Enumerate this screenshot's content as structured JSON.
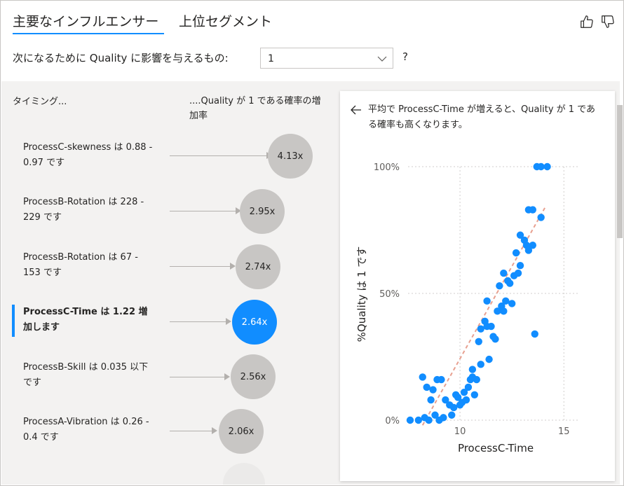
{
  "tabs": [
    {
      "label": "主要なインフルエンサー",
      "active": true
    },
    {
      "label": "上位セグメント",
      "active": false
    }
  ],
  "feedback": {
    "like_icon": "thumbs-up-icon",
    "dislike_icon": "thumbs-down-icon"
  },
  "question": {
    "text": "次になるために Quality に影響を与えるもの:",
    "selected_value": "1",
    "help": "?"
  },
  "influencers": {
    "col_header_left": "タイミング...",
    "col_header_right": "....Quality が 1 である確率の増加率",
    "items": [
      {
        "label": "ProcessC-skewness は 0.88 - 0.97 です",
        "multiplier": "4.13x",
        "value": 4.13,
        "selected": false
      },
      {
        "label": "ProcessB-Rotation は 228 - 229 です",
        "multiplier": "2.95x",
        "value": 2.95,
        "selected": false
      },
      {
        "label": "ProcessB-Rotation は 67 - 153 です",
        "multiplier": "2.74x",
        "value": 2.74,
        "selected": false
      },
      {
        "label": "ProcessC-Time は 1.22 増加します",
        "multiplier": "2.64x",
        "value": 2.64,
        "selected": true
      },
      {
        "label": "ProcessB-Skill は 0.035 以下です",
        "multiplier": "2.56x",
        "value": 2.56,
        "selected": false
      },
      {
        "label": "ProcessA-Vibration は 0.26 - 0.4 です",
        "multiplier": "2.06x",
        "value": 2.06,
        "selected": false
      }
    ]
  },
  "detail": {
    "back_icon": "arrow-left-icon",
    "description": "平均で ProcessC-Time が増えると、Quality が 1 である確率も高くなります。"
  },
  "chart_data": {
    "type": "scatter",
    "xlabel": "ProcessC-Time",
    "ylabel": "%Quality は 1 です",
    "xlim": [
      7.5,
      15.7
    ],
    "ylim": [
      0,
      100
    ],
    "x_ticks": [
      10,
      15
    ],
    "y_ticks": [
      {
        "value": 0,
        "label": "0%"
      },
      {
        "value": 50,
        "label": "50%"
      },
      {
        "value": 100,
        "label": "100%"
      }
    ],
    "grid": true,
    "point_color": "#118dff",
    "trend_color": "#e8a090",
    "trendline": {
      "x": [
        8.2,
        14.1
      ],
      "y": [
        -2,
        84
      ]
    },
    "points": [
      [
        7.6,
        0
      ],
      [
        8.0,
        0
      ],
      [
        8.5,
        0
      ],
      [
        9.0,
        0
      ],
      [
        8.3,
        1
      ],
      [
        8.8,
        2
      ],
      [
        9.2,
        1
      ],
      [
        9.6,
        2
      ],
      [
        8.2,
        17
      ],
      [
        8.4,
        13
      ],
      [
        8.7,
        12
      ],
      [
        8.6,
        8
      ],
      [
        8.9,
        16
      ],
      [
        9.1,
        16
      ],
      [
        9.3,
        8
      ],
      [
        9.5,
        6
      ],
      [
        9.7,
        5
      ],
      [
        9.8,
        10
      ],
      [
        9.9,
        9
      ],
      [
        10.0,
        6
      ],
      [
        10.1,
        7
      ],
      [
        10.2,
        11
      ],
      [
        10.3,
        8
      ],
      [
        10.4,
        13
      ],
      [
        10.5,
        16
      ],
      [
        10.6,
        17
      ],
      [
        10.6,
        20
      ],
      [
        10.7,
        10
      ],
      [
        10.8,
        16
      ],
      [
        10.9,
        31
      ],
      [
        11.0,
        22
      ],
      [
        11.0,
        36
      ],
      [
        11.2,
        39
      ],
      [
        11.3,
        37
      ],
      [
        11.3,
        47
      ],
      [
        11.4,
        24
      ],
      [
        11.5,
        37
      ],
      [
        11.6,
        33
      ],
      [
        11.7,
        32
      ],
      [
        11.8,
        43
      ],
      [
        11.9,
        53
      ],
      [
        12.0,
        45
      ],
      [
        12.1,
        43
      ],
      [
        12.1,
        58
      ],
      [
        12.2,
        47
      ],
      [
        12.3,
        55
      ],
      [
        12.4,
        54
      ],
      [
        12.5,
        46
      ],
      [
        12.6,
        57
      ],
      [
        12.7,
        66
      ],
      [
        12.8,
        58
      ],
      [
        12.9,
        61
      ],
      [
        12.9,
        73
      ],
      [
        13.1,
        71
      ],
      [
        13.2,
        69
      ],
      [
        13.3,
        67
      ],
      [
        13.5,
        69
      ],
      [
        13.6,
        34
      ],
      [
        13.3,
        83
      ],
      [
        13.5,
        83
      ],
      [
        13.9,
        80
      ],
      [
        13.7,
        100
      ],
      [
        13.9,
        100
      ],
      [
        14.2,
        100
      ]
    ]
  }
}
